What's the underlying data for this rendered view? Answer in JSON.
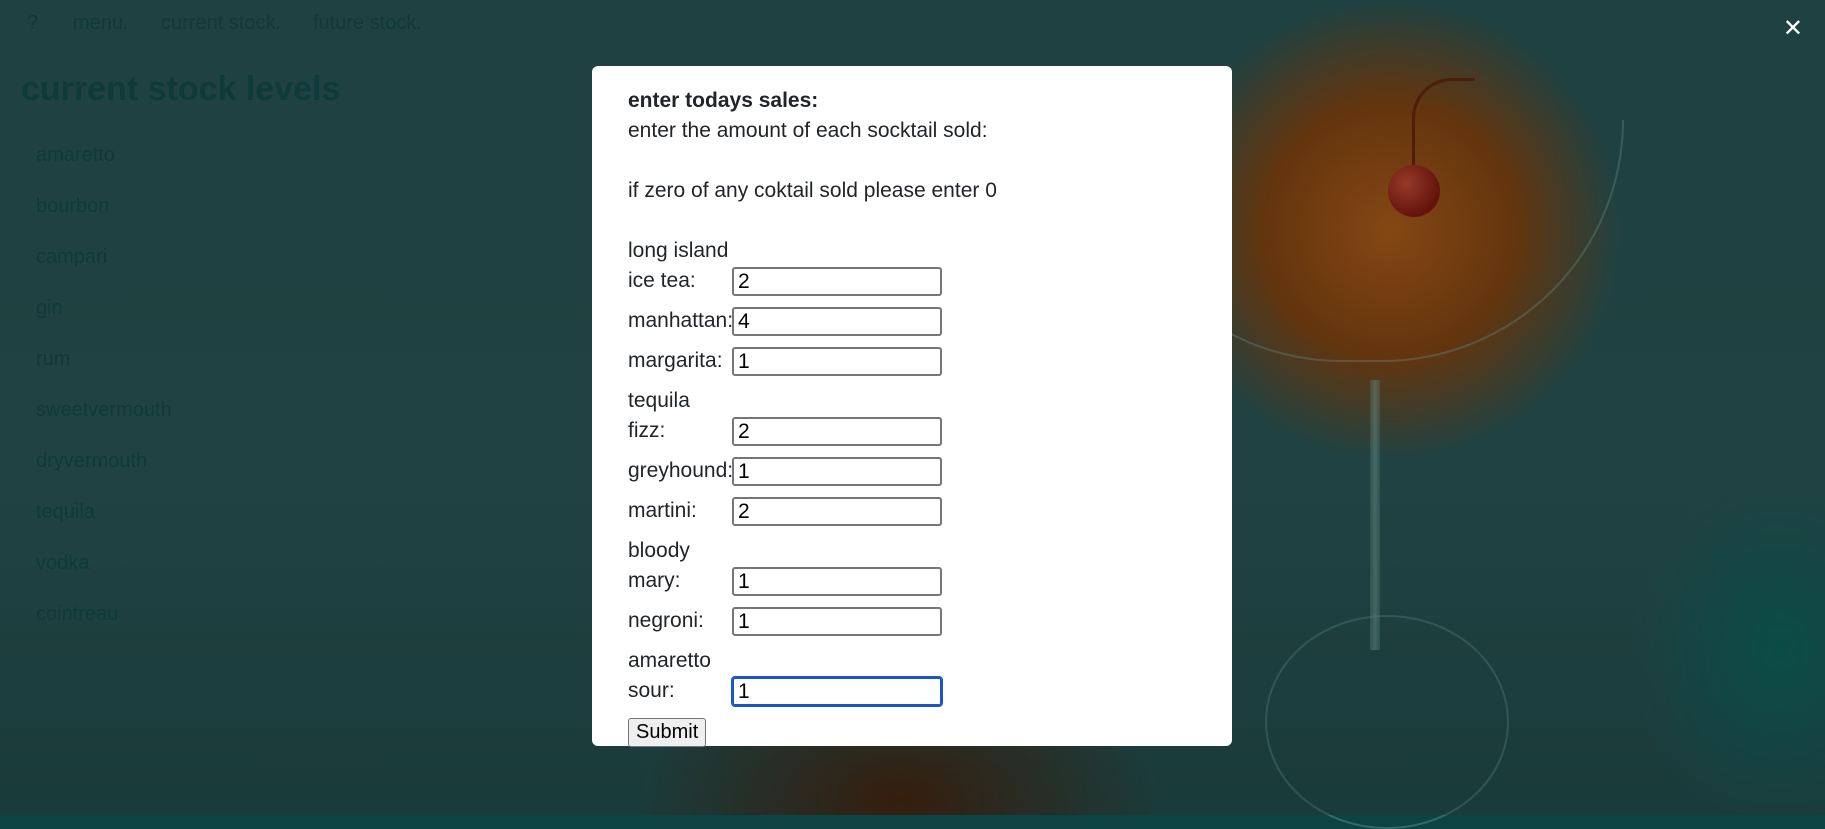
{
  "nav": {
    "help": "?",
    "menu": "menu.",
    "current_stock": "current stock.",
    "future_stock": "future stock.",
    "close": "✕"
  },
  "page": {
    "title": "current stock levels",
    "items": [
      "amaretto",
      "bourbon",
      "campari",
      "gin",
      "rum",
      "sweetvermouth",
      "dryvermouth",
      "tequila",
      "vodka",
      "cointreau"
    ]
  },
  "modal": {
    "title": "enter todays sales:",
    "instruction": "enter the amount of each socktail sold:",
    "note": "if zero of any coktail sold please enter 0",
    "fields": [
      {
        "label_line1": "long island",
        "label_line2": "ice tea:",
        "value": "2"
      },
      {
        "label_line1": "",
        "label_line2": "manhattan:",
        "value": "4"
      },
      {
        "label_line1": "",
        "label_line2": "margarita:",
        "value": "1"
      },
      {
        "label_line1": "",
        "label_line2": "tequila fizz:",
        "value": "2"
      },
      {
        "label_line1": "",
        "label_line2": "greyhound:",
        "value": "1"
      },
      {
        "label_line1": "",
        "label_line2": "martini:",
        "value": "2"
      },
      {
        "label_line1": "bloody",
        "label_line2": "mary:",
        "value": "1"
      },
      {
        "label_line1": "",
        "label_line2": "negroni:",
        "value": "1"
      },
      {
        "label_line1": "amaretto",
        "label_line2": "sour:",
        "value": "1"
      }
    ],
    "submit": "Submit"
  }
}
